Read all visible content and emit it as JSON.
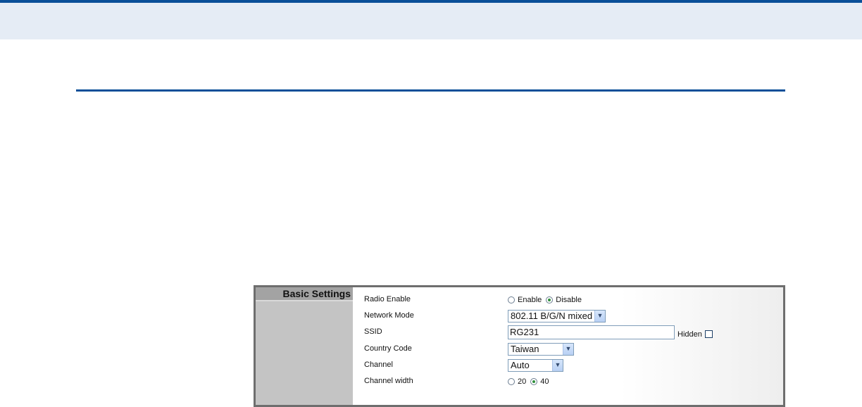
{
  "panel": {
    "section_title": "Basic Settings"
  },
  "rows": {
    "radio_enable": {
      "label": "Radio Enable",
      "options": [
        "Enable",
        "Disable"
      ],
      "selected": "Disable"
    },
    "network_mode": {
      "label": "Network Mode",
      "value": "802.11 B/G/N mixed"
    },
    "ssid": {
      "label": "SSID",
      "value": "RG231",
      "hidden_label": "Hidden",
      "hidden_checked": false
    },
    "country_code": {
      "label": "Country Code",
      "value": "Taiwan"
    },
    "channel": {
      "label": "Channel",
      "value": "Auto"
    },
    "channel_width": {
      "label": "Channel width",
      "options": [
        "20",
        "40"
      ],
      "selected": "40"
    }
  },
  "icons": {
    "dropdown": "chevron-down-icon"
  },
  "colors": {
    "accent_blue": "#0a4f98",
    "radio_dot": "#2f8f3b"
  }
}
